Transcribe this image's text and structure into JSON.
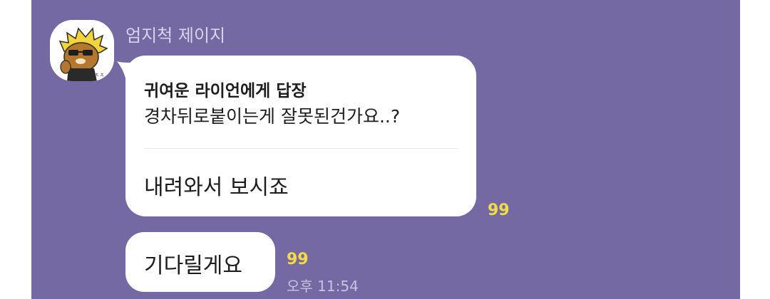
{
  "colors": {
    "chat_background": "#7569a3",
    "bubble": "#ffffff",
    "unread_count": "#f2dc46",
    "page_background": "#ffffff"
  },
  "message_group": {
    "sender_name": "엄지척 제이지",
    "avatar_icon": "ryan-thumbs-up-sticker-icon",
    "reply_bubble": {
      "title": "귀여운 라이언에게 답장",
      "quoted_text": "경차뒤로붙이는게 잘못된건가요..?",
      "message": "내려와서 보시죠",
      "unread_count": "99"
    },
    "second_bubble": {
      "message": "기다릴게요",
      "unread_count": "99",
      "time": "오후 11:54"
    }
  }
}
